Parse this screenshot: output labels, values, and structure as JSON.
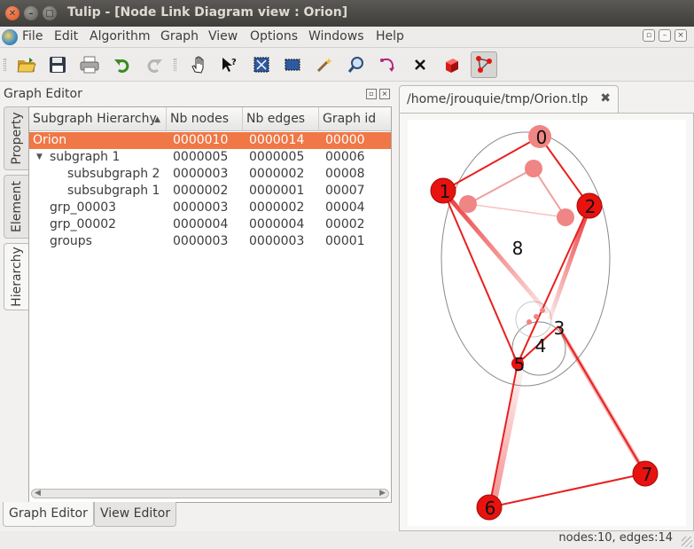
{
  "window": {
    "title": "Tulip - [Node Link Diagram view : Orion]"
  },
  "menubar": {
    "items": [
      "File",
      "Edit",
      "Algorithm",
      "Graph",
      "View",
      "Options",
      "Windows",
      "Help"
    ]
  },
  "toolbar": {
    "tools": [
      {
        "icon": "open-folder-icon"
      },
      {
        "icon": "save-disk-icon"
      },
      {
        "icon": "printer-icon"
      },
      {
        "icon": "undo-icon"
      },
      {
        "icon": "redo-icon"
      },
      {
        "icon": "hand-navigate-icon"
      },
      {
        "icon": "get-info-cursor-icon"
      },
      {
        "icon": "select-rectangle-icon"
      },
      {
        "icon": "selection-icon"
      },
      {
        "icon": "magic-wand-icon"
      },
      {
        "icon": "zoom-magnifier-icon"
      },
      {
        "icon": "add-edge-icon"
      },
      {
        "icon": "delete-x-icon"
      },
      {
        "icon": "add-node-cube-icon"
      },
      {
        "icon": "edit-edge-bends-icon"
      }
    ],
    "active_tool": "edit-edge-bends-icon"
  },
  "graph_editor": {
    "title": "Graph Editor",
    "side_tabs": [
      "Property",
      "Element",
      "Hierarchy"
    ],
    "active_side_tab": "Hierarchy",
    "columns": [
      "Subgraph Hierarchy",
      "Nb nodes",
      "Nb edges",
      "Graph id"
    ],
    "rows": [
      {
        "name": "Orion",
        "nodes": "0000010",
        "edges": "0000014",
        "id": "00000",
        "level": 0,
        "selected": true
      },
      {
        "name": "subgraph 1",
        "nodes": "0000005",
        "edges": "0000005",
        "id": "00006",
        "level": 1,
        "expanded": true
      },
      {
        "name": "subsubgraph 2",
        "nodes": "0000003",
        "edges": "0000002",
        "id": "00008",
        "level": 2
      },
      {
        "name": "subsubgraph 1",
        "nodes": "0000002",
        "edges": "0000001",
        "id": "00007",
        "level": 2
      },
      {
        "name": "grp_00003",
        "nodes": "0000003",
        "edges": "0000002",
        "id": "00004",
        "level": 1
      },
      {
        "name": "grp_00002",
        "nodes": "0000004",
        "edges": "0000004",
        "id": "00002",
        "level": 1
      },
      {
        "name": "groups",
        "nodes": "0000003",
        "edges": "0000003",
        "id": "00001",
        "level": 1
      }
    ],
    "bottom_tabs": [
      "Graph Editor",
      "View Editor"
    ]
  },
  "view": {
    "tab_label": "/home/jrouquie/tmp/Orion.tlp",
    "node_labels": [
      "0",
      "1",
      "2",
      "3",
      "4",
      "5",
      "6",
      "7",
      "8"
    ],
    "colors": {
      "node": "#e8120f",
      "edge": "#e81f1f",
      "faded_node": "#f08585",
      "meta_outline": "#8a8a8a"
    }
  },
  "status": {
    "text": "nodes:10, edges:14"
  },
  "colors": {
    "selection": "#f07746",
    "titlebar": "#3f3e3a"
  }
}
